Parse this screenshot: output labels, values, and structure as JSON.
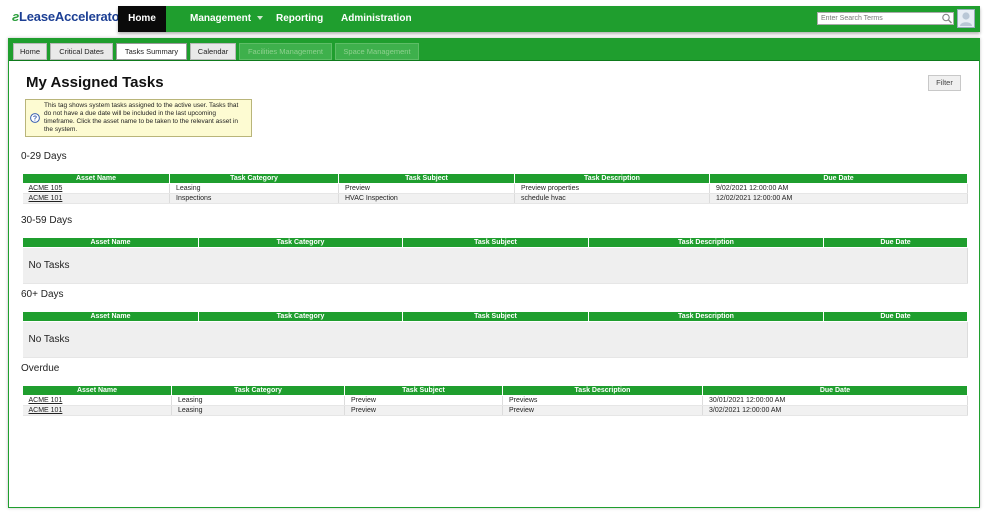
{
  "brand": {
    "name": "LeaseAccelerator"
  },
  "topnav": {
    "home": "Home",
    "management": "Management",
    "reporting": "Reporting",
    "administration": "Administration"
  },
  "search": {
    "placeholder": "Enter Search Terms"
  },
  "subnav": {
    "tabs": [
      "Home",
      "Critical Dates",
      "Tasks Summary",
      "Calendar",
      "Facilities Management",
      "Space Management"
    ],
    "active": "Tasks Summary"
  },
  "page": {
    "title": "My Assigned Tasks",
    "filter_label": "Filter",
    "info": "This tag shows system tasks assigned to the active user. Tasks that do not have a due date will be included in the last upcoming timeframe. Click the asset name to be taken to the relevant asset in the system."
  },
  "columns": [
    "Asset Name",
    "Task Category",
    "Task Subject",
    "Task Description",
    "Due Date"
  ],
  "sections": [
    {
      "title": "0-29 Days",
      "rows": [
        [
          "ACME 105",
          "Leasing",
          "Preview",
          "Preview properties",
          "9/02/2021 12:00:00 AM"
        ],
        [
          "ACME 101",
          "Inspections",
          "HVAC Inspection",
          "schedule hvac",
          "12/02/2021 12:00:00 AM"
        ]
      ]
    },
    {
      "title": "30-59 Days",
      "empty_text": "No Tasks"
    },
    {
      "title": "60+ Days",
      "empty_text": "No Tasks"
    },
    {
      "title": "Overdue",
      "rows": [
        [
          "ACME 101",
          "Leasing",
          "Preview",
          "Previews",
          "30/01/2021 12:00:00 AM"
        ],
        [
          "ACME 101",
          "Leasing",
          "Preview",
          "Preview",
          "3/02/2021 12:00:00 AM"
        ]
      ]
    }
  ],
  "colors": {
    "brand_green": "#1f9e2e",
    "logo_blue": "#1c3f94",
    "info_bg": "#fdfbd2"
  },
  "icons": [
    "search-icon",
    "user-avatar-icon",
    "info-icon",
    "chevron-down-icon"
  ]
}
